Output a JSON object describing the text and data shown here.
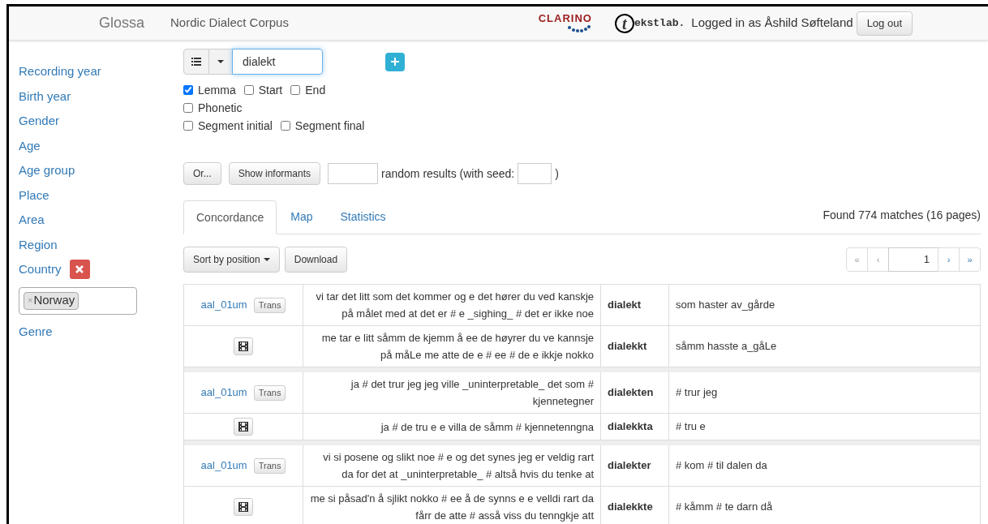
{
  "navbar": {
    "brand": "Glossa",
    "corpus": "Nordic Dialect Corpus",
    "logos": [
      {
        "kind": "clarino",
        "text": "CLARINO"
      },
      {
        "kind": "tekstlab",
        "initial": "t",
        "text": "ekstlab."
      }
    ],
    "user": "Logged in as Åshild Søfteland",
    "logout": "Log out"
  },
  "sidebar": {
    "items": [
      {
        "label": "Recording year"
      },
      {
        "label": "Birth year"
      },
      {
        "label": "Gender"
      },
      {
        "label": "Age"
      },
      {
        "label": "Age group"
      },
      {
        "label": "Place"
      },
      {
        "label": "Area"
      },
      {
        "label": "Region"
      },
      {
        "label": "Country",
        "removable": true,
        "tokens": [
          {
            "remove": "×",
            "label": "Norway"
          }
        ]
      },
      {
        "label": "Genre"
      }
    ]
  },
  "search": {
    "value": "dialekt",
    "option_rows": [
      [
        {
          "label": "Lemma",
          "checked": true
        },
        {
          "label": "Start",
          "checked": false
        },
        {
          "label": "End",
          "checked": false
        }
      ],
      [
        {
          "label": "Phonetic",
          "checked": false
        }
      ],
      [
        {
          "label": "Segment initial",
          "checked": false
        },
        {
          "label": "Segment final",
          "checked": false
        }
      ]
    ],
    "or_button": "Or...",
    "show_informants": "Show informants",
    "random_label": "random results (with seed:",
    "random_close": ")"
  },
  "tabs": [
    {
      "label": "Concordance",
      "selected": true
    },
    {
      "label": "Map",
      "selected": false
    },
    {
      "label": "Statistics",
      "selected": false
    }
  ],
  "found": "Found 774 matches (16 pages)",
  "sort_button": "Sort by position",
  "download_button": "Download",
  "pagination": {
    "first": "«",
    "prev": "‹",
    "page": "1",
    "next": "›",
    "last": "»"
  },
  "results": [
    {
      "informant": "aal_01um",
      "trans": "Trans",
      "orthographic": {
        "left": "vi tar det litt som det kommer og e det hører du ved kanskje på målet med at det er # e _sighing_ # det er ikke noe",
        "match": "dialekt",
        "right": "som haster av_gårde"
      },
      "phonetic": {
        "left": "me tar e litt såmm de kjemm å ee de høyrer du ve kannsje på måLe me atte de e # ee # de e ikkje nokko",
        "match": "dialekkt",
        "right": "såmm hasste a_gåLe"
      }
    },
    {
      "informant": "aal_01um",
      "trans": "Trans",
      "orthographic": {
        "left": "ja # det trur jeg jeg ville _uninterpretable_ det som # kjennetegner",
        "match": "dialekten",
        "right": "# trur jeg"
      },
      "phonetic": {
        "left": "ja # de tru e e villa de såmm # kjennetenngna",
        "match": "dialekkta",
        "right": "# tru e"
      }
    },
    {
      "informant": "aal_01um",
      "trans": "Trans",
      "orthographic": {
        "left": "vi si posene og slikt noe # e og det synes jeg er veldig rart da for det at _uninterpretable_ # altså hvis du tenke at",
        "match": "dialekter",
        "right": "# kom # til dalen da"
      },
      "phonetic": {
        "left": "me si påsad'n å sjlikt nokko # ee å de synns e e velldi rart da fårr de atte # asså viss du tenngkje att",
        "match": "dialekkte",
        "right": "# kåmm # te darn då"
      }
    }
  ]
}
